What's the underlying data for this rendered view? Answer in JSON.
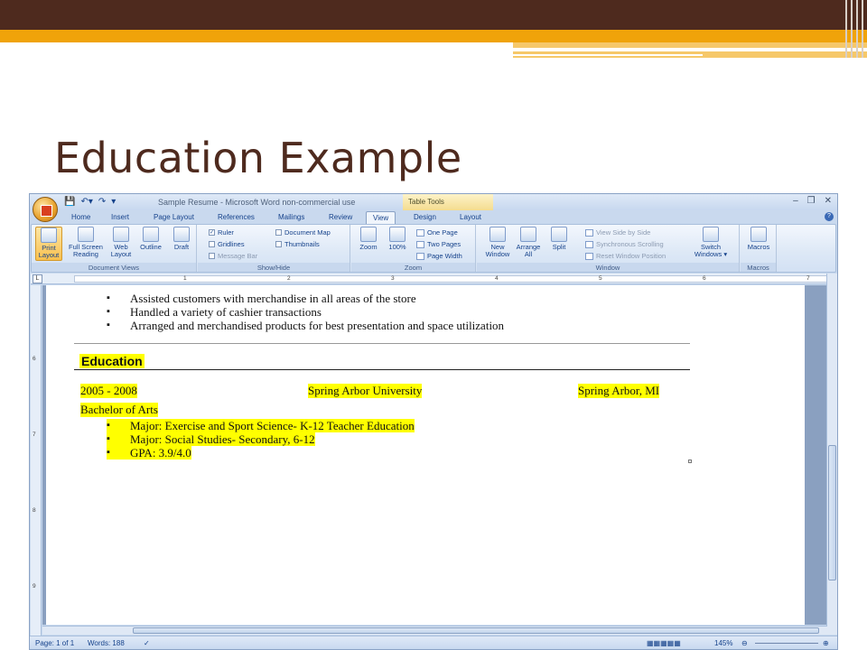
{
  "slide": {
    "title": "Education Example"
  },
  "window": {
    "title": "Sample Resume - Microsoft Word non-commercial use",
    "contextual_tab": "Table Tools",
    "controls": [
      "–",
      "❐",
      "✕"
    ]
  },
  "tabs": [
    "Home",
    "Insert",
    "Page Layout",
    "References",
    "Mailings",
    "Review",
    "View",
    "Design",
    "Layout"
  ],
  "ribbon": {
    "document_views": {
      "label": "Document Views",
      "print_layout": [
        "Print",
        "Layout"
      ],
      "full_screen": [
        "Full Screen",
        "Reading"
      ],
      "web_layout": [
        "Web",
        "Layout"
      ],
      "outline": "Outline",
      "draft": "Draft"
    },
    "show_hide": {
      "label": "Show/Hide",
      "ruler": "Ruler",
      "gridlines": "Gridlines",
      "message_bar": "Message Bar",
      "document_map": "Document Map",
      "thumbnails": "Thumbnails"
    },
    "zoom": {
      "label": "Zoom",
      "zoom": "Zoom",
      "hundred": "100%",
      "one_page": "One Page",
      "two_pages": "Two Pages",
      "page_width": "Page Width"
    },
    "window": {
      "label": "Window",
      "new_window": [
        "New",
        "Window"
      ],
      "arrange_all": [
        "Arrange",
        "All"
      ],
      "split": "Split",
      "side_by_side": "View Side by Side",
      "sync_scroll": "Synchronous Scrolling",
      "reset_pos": "Reset Window Position",
      "switch": [
        "Switch",
        "Windows ▾"
      ]
    },
    "macros": {
      "label": "Macros",
      "macros": "Macros"
    }
  },
  "ruler": {
    "numbers": [
      "1",
      "2",
      "3",
      "4",
      "5",
      "6",
      "7"
    ]
  },
  "vruler": {
    "numbers": [
      "6",
      "7",
      "8",
      "9"
    ]
  },
  "document": {
    "prev_bullets": [
      "Assisted customers with merchandise in all areas of the store",
      "Handled a variety of cashier transactions",
      "Arranged and merchandised products for best presentation and space utilization"
    ],
    "section_heading": "Education",
    "years": "2005 - 2008",
    "school": "Spring Arbor University",
    "location": "Spring Arbor, MI",
    "degree": "Bachelor of Arts",
    "details": [
      "Major: Exercise and Sport Science- K-12 Teacher Education",
      "Major: Social Studies- Secondary, 6-12",
      "GPA: 3.9/4.0"
    ]
  },
  "status": {
    "page": "Page: 1 of 1",
    "words": "Words: 188",
    "zoom": "145%"
  }
}
